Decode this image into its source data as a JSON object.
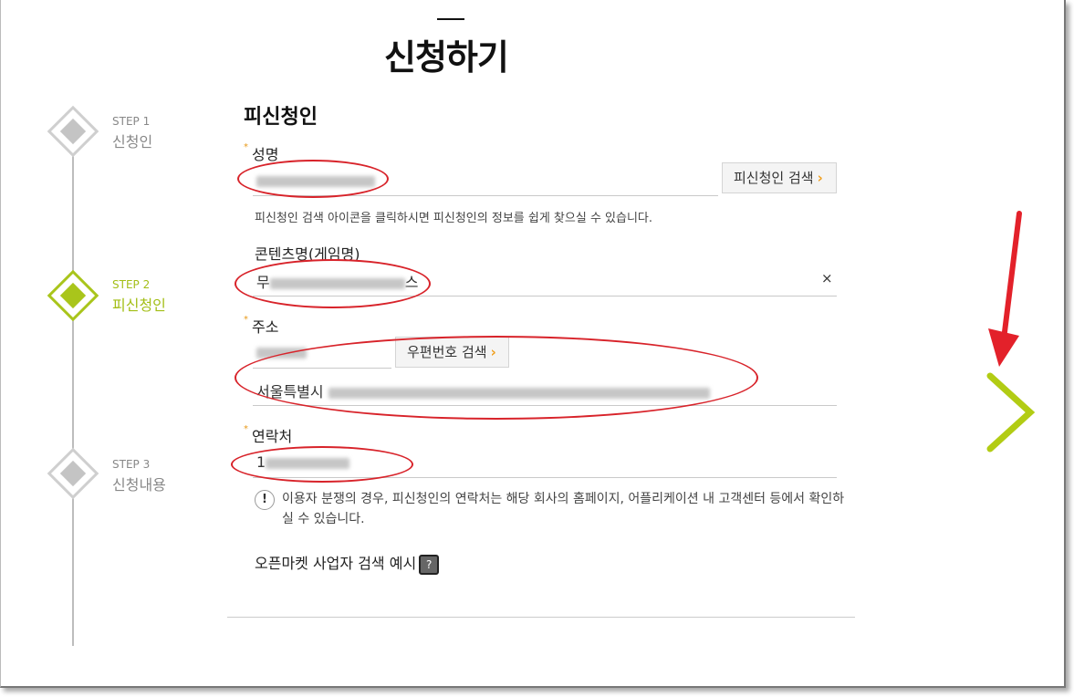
{
  "page": {
    "title": "신청하기"
  },
  "steps": [
    {
      "num": "STEP 1",
      "label": "신청인",
      "active": false
    },
    {
      "num": "STEP 2",
      "label": "피신청인",
      "active": true
    },
    {
      "num": "STEP 3",
      "label": "신청내용",
      "active": false
    }
  ],
  "form": {
    "section_title": "피신청인",
    "name": {
      "label": "성명",
      "search_button": "피신청인 검색",
      "hint": "피신청인 검색 아이콘을 클릭하시면 피신청인의 정보를 쉽게 찾으실 수 있습니다."
    },
    "content": {
      "label": "콘텐츠명(게임명)",
      "value_prefix": "무",
      "value_suffix": "스",
      "clear": "×"
    },
    "address": {
      "label": "주소",
      "postcode_button": "우편번호 검색",
      "value_prefix": "서울특별시"
    },
    "contact": {
      "label": "연락처",
      "value_prefix": "1"
    },
    "notice": {
      "icon": "!",
      "text": "이용자 분쟁의 경우, 피신청인의 연락처는 해당 회사의 홈페이지, 어플리케이션 내 고객센터 등에서 확인하실 수 있습니다."
    },
    "example": {
      "label": "오픈마켓 사업자 검색 예시",
      "icon": "?"
    }
  },
  "colors": {
    "accent": "#a9c51b",
    "annotation": "#d8232a",
    "required": "#e89a1a"
  },
  "icons": {
    "next": "chevron-right-icon",
    "pointer": "red-arrow-icon"
  }
}
